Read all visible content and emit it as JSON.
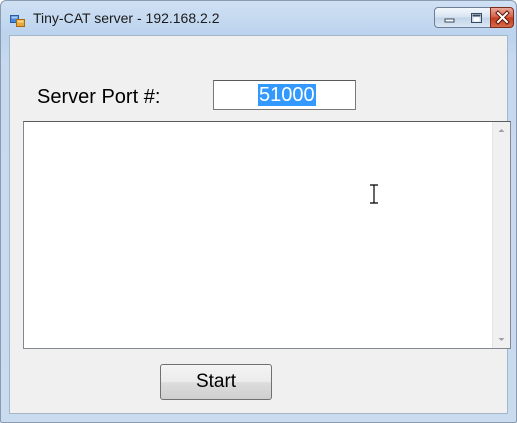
{
  "window": {
    "title": "Tiny-CAT server - 192.168.2.2",
    "icon": "app-window-icon",
    "controls": [
      "minimize-icon",
      "maximize-icon",
      "close-icon"
    ]
  },
  "form": {
    "port_label": "Server Port #:",
    "port_value": "51000",
    "log_text": "",
    "start_label": "Start"
  },
  "colors": {
    "selection": "#3399ff",
    "close_button": "#c23a1c",
    "title_bar": "#c6d9ef"
  }
}
